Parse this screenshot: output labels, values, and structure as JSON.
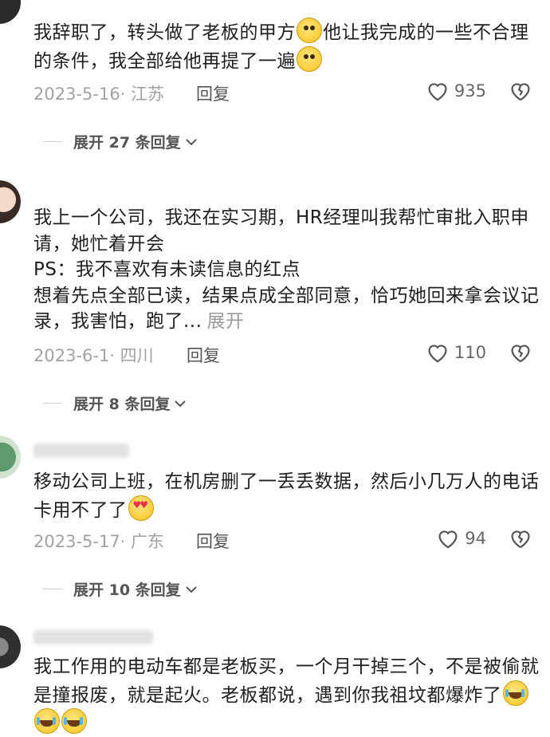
{
  "comments": [
    {
      "text": "我辞职了，转头做了老板的甲方",
      "text_tail": "他让我完成的一些不合理的条件，我全部给他再提了一遍",
      "emoji": "grimacing-face-emoji",
      "date_location": "2023-5-16· 江苏",
      "reply_label": "回复",
      "likes": "935",
      "expand_label": "展开 27 条回复"
    },
    {
      "text_lines": [
        "我上一个公司，我还在实习期，HR经理叫我帮忙审批入职申请，她忙着开会",
        "PS：我不喜欢有未读信息的红点",
        "想着先点全部已读，结果点成全部同意，恰巧她回来拿会议记录，我害怕，跑了..."
      ],
      "more_label": "展开",
      "date_location": "2023-6-1· 四川",
      "reply_label": "回复",
      "likes": "110",
      "expand_label": "展开 8 条回复"
    },
    {
      "text": "移动公司上班，在机房删了一丢丢数据，然后小几万人的电话卡用不了了",
      "emoji": "heart-eyes-emoji",
      "date_location": "2023-5-17· 广东",
      "reply_label": "回复",
      "likes": "94",
      "expand_label": "展开 10 条回复"
    },
    {
      "text": "我工作用的电动车都是老板买，一个月干掉三个，不是被偷就是撞报废，就是起火。老板都说，遇到你我祖坟都爆炸了",
      "emoji": "crying-face-emoji"
    }
  ]
}
